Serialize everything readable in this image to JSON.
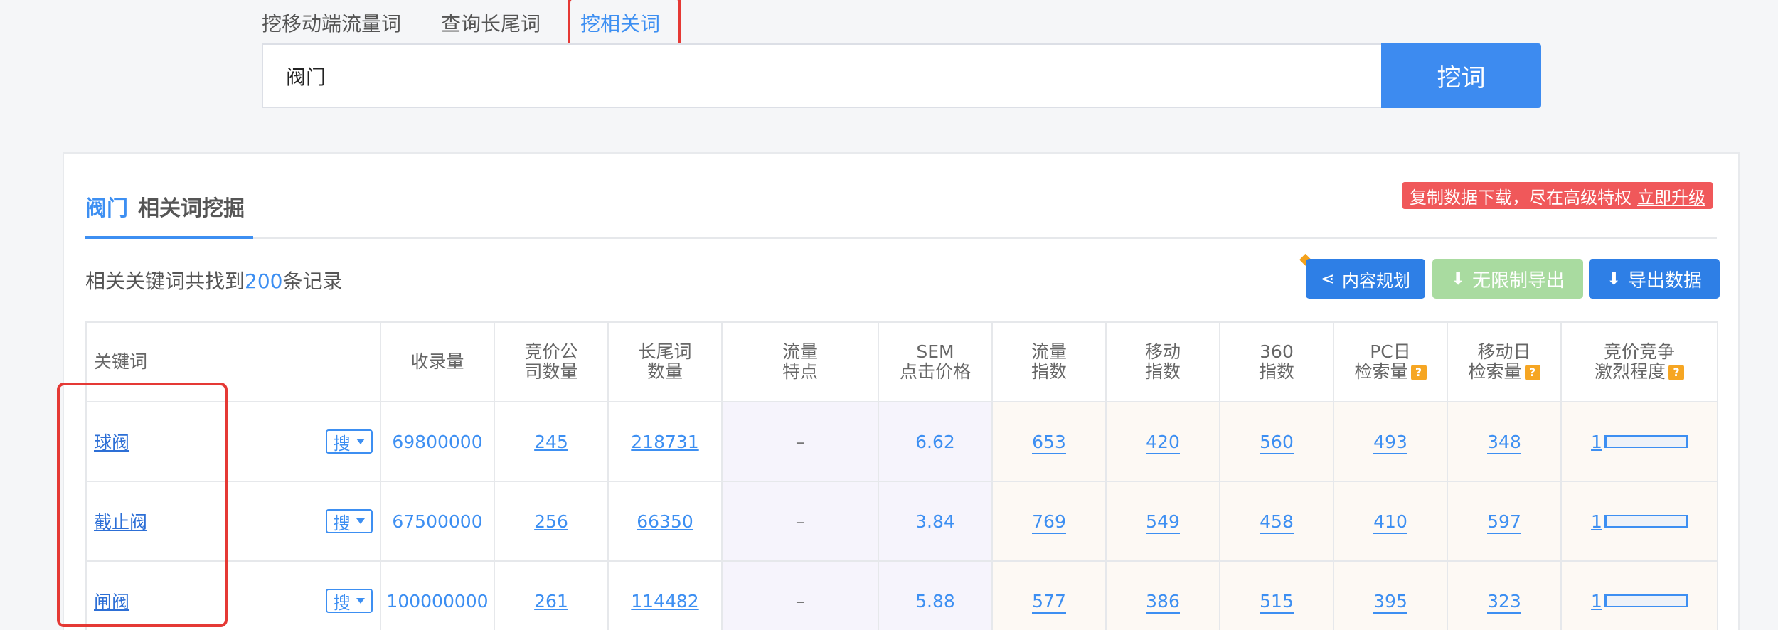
{
  "tabs": [
    {
      "label": "挖移动端流量词",
      "active": false
    },
    {
      "label": "查询长尾词",
      "active": false
    },
    {
      "label": "挖相关词",
      "active": true
    }
  ],
  "search": {
    "value": "阀门",
    "button": "挖词"
  },
  "panel": {
    "title_keyword": "阀门",
    "title_suffix": "相关词挖掘",
    "upgrade_text": "复制数据下载，尽在高级特权",
    "upgrade_link": "立即升级",
    "record_prefix": "相关关键词共找到",
    "record_count": "200",
    "record_suffix": "条记录",
    "buttons": {
      "plan": "内容规划",
      "free_export": "无限制导出",
      "export": "导出数据"
    }
  },
  "table": {
    "headers": [
      {
        "line1": "关键词",
        "line2": ""
      },
      {
        "line1": "收录量",
        "line2": ""
      },
      {
        "line1": "竞价公",
        "line2": "司数量"
      },
      {
        "line1": "长尾词",
        "line2": "数量"
      },
      {
        "line1": "流量",
        "line2": "特点"
      },
      {
        "line1": "SEM",
        "line2": "点击价格"
      },
      {
        "line1": "流量",
        "line2": "指数"
      },
      {
        "line1": "移动",
        "line2": "指数"
      },
      {
        "line1": "360",
        "line2": "指数"
      },
      {
        "line1": "PC日",
        "line2": "检索量"
      },
      {
        "line1": "移动日",
        "line2": "检索量"
      },
      {
        "line1": "竞价竞争",
        "line2": "激烈程度"
      }
    ],
    "search_button": "搜",
    "rows": [
      {
        "keyword": "球阀",
        "indexed": "69800000",
        "bid_companies": "245",
        "longtail": "218731",
        "traffic": "–",
        "sem": "6.62",
        "traffic_index": "653",
        "mobile_index": "420",
        "index_360": "560",
        "pc_daily": "493",
        "mobile_daily": "348",
        "competition": "1",
        "competition_level": 0.03
      },
      {
        "keyword": "截止阀",
        "indexed": "67500000",
        "bid_companies": "256",
        "longtail": "66350",
        "traffic": "–",
        "sem": "3.84",
        "traffic_index": "769",
        "mobile_index": "549",
        "index_360": "458",
        "pc_daily": "410",
        "mobile_daily": "597",
        "competition": "1",
        "competition_level": 0.03
      },
      {
        "keyword": "闸阀",
        "indexed": "100000000",
        "bid_companies": "261",
        "longtail": "114482",
        "traffic": "–",
        "sem": "5.88",
        "traffic_index": "577",
        "mobile_index": "386",
        "index_360": "515",
        "pc_daily": "395",
        "mobile_daily": "323",
        "competition": "1",
        "competition_level": 0.03
      }
    ]
  }
}
